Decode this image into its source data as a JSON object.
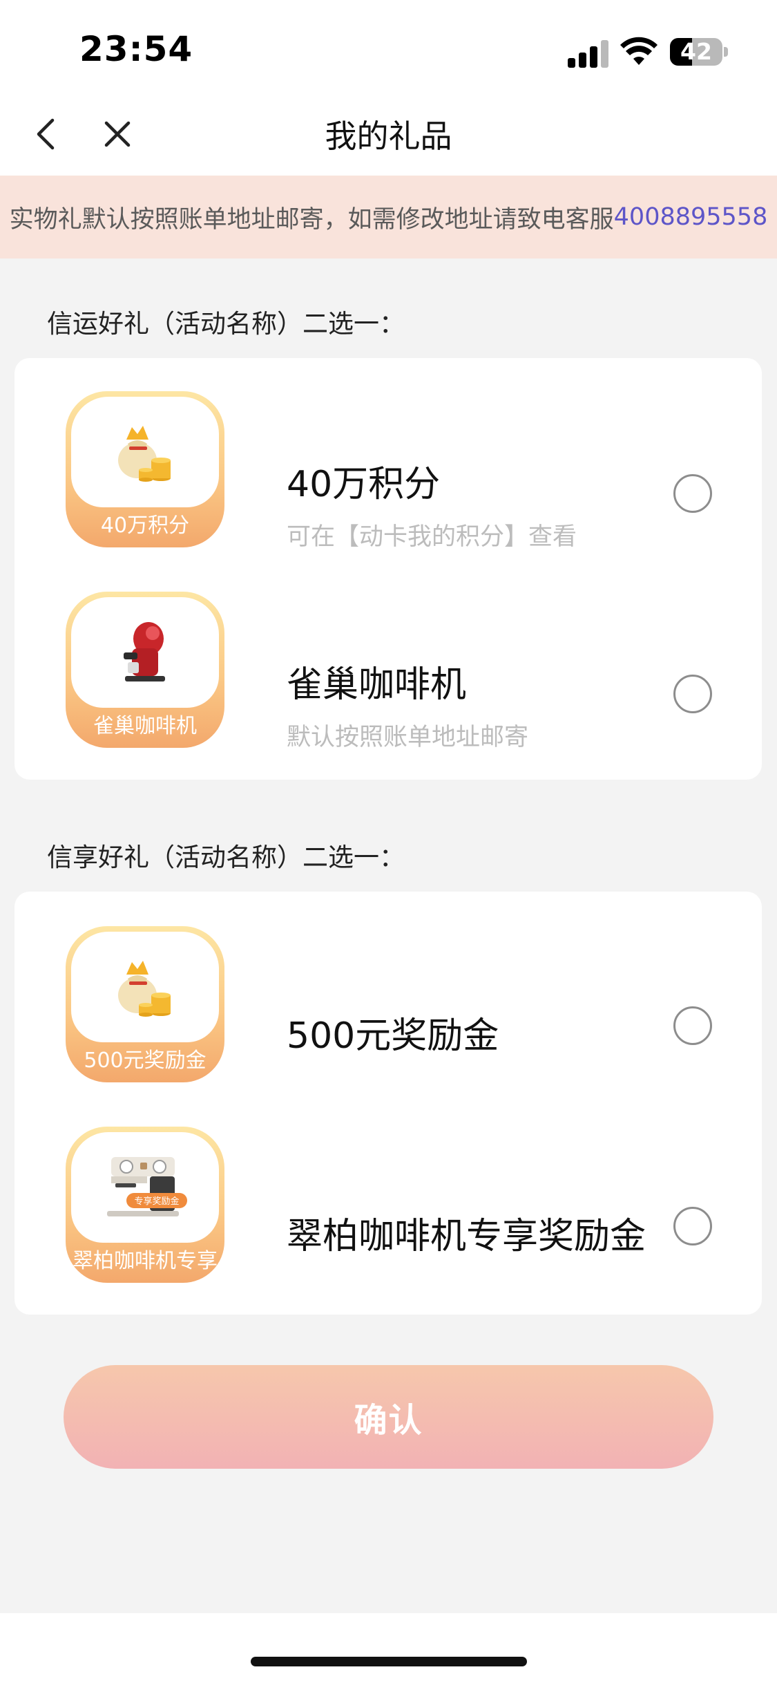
{
  "status_bar": {
    "time": "23:54",
    "battery_level": "42"
  },
  "nav": {
    "title": "我的礼品",
    "back_icon": "chevron-left-icon",
    "close_icon": "close-icon"
  },
  "notice": {
    "text": "实物礼默认按照账单地址邮寄，如需修改地址请致电客服",
    "phone": "4008895558"
  },
  "groups": [
    {
      "title": "信运好礼（活动名称）二选一：",
      "options": [
        {
          "title": "40万积分",
          "subtitle": "可在【动卡我的积分】查看",
          "thumb_label": "40万积分",
          "thumb_icon": "money-bag-coins-icon",
          "selected": false
        },
        {
          "title": "雀巢咖啡机",
          "subtitle": "默认按照账单地址邮寄",
          "thumb_label": "雀巢咖啡机",
          "thumb_icon": "red-coffee-machine-icon",
          "selected": false
        }
      ]
    },
    {
      "title": "信享好礼（活动名称）二选一：",
      "options": [
        {
          "title": "500元奖励金",
          "subtitle": "",
          "thumb_label": "500元奖励金",
          "thumb_icon": "money-bag-coins-icon",
          "selected": false
        },
        {
          "title": "翠柏咖啡机专享奖励金",
          "subtitle": "",
          "thumb_label": "翠柏咖啡机专享",
          "thumb_icon": "espresso-machine-icon",
          "thumb_badge": "专享奖励金",
          "selected": false
        }
      ]
    }
  ],
  "confirm_button": {
    "label": "确认"
  },
  "colors": {
    "accent_link": "#5d55c8",
    "notice_bg": "#f9e3db",
    "confirm_start": "#f6c7ac",
    "confirm_end": "#f2b2b4"
  }
}
